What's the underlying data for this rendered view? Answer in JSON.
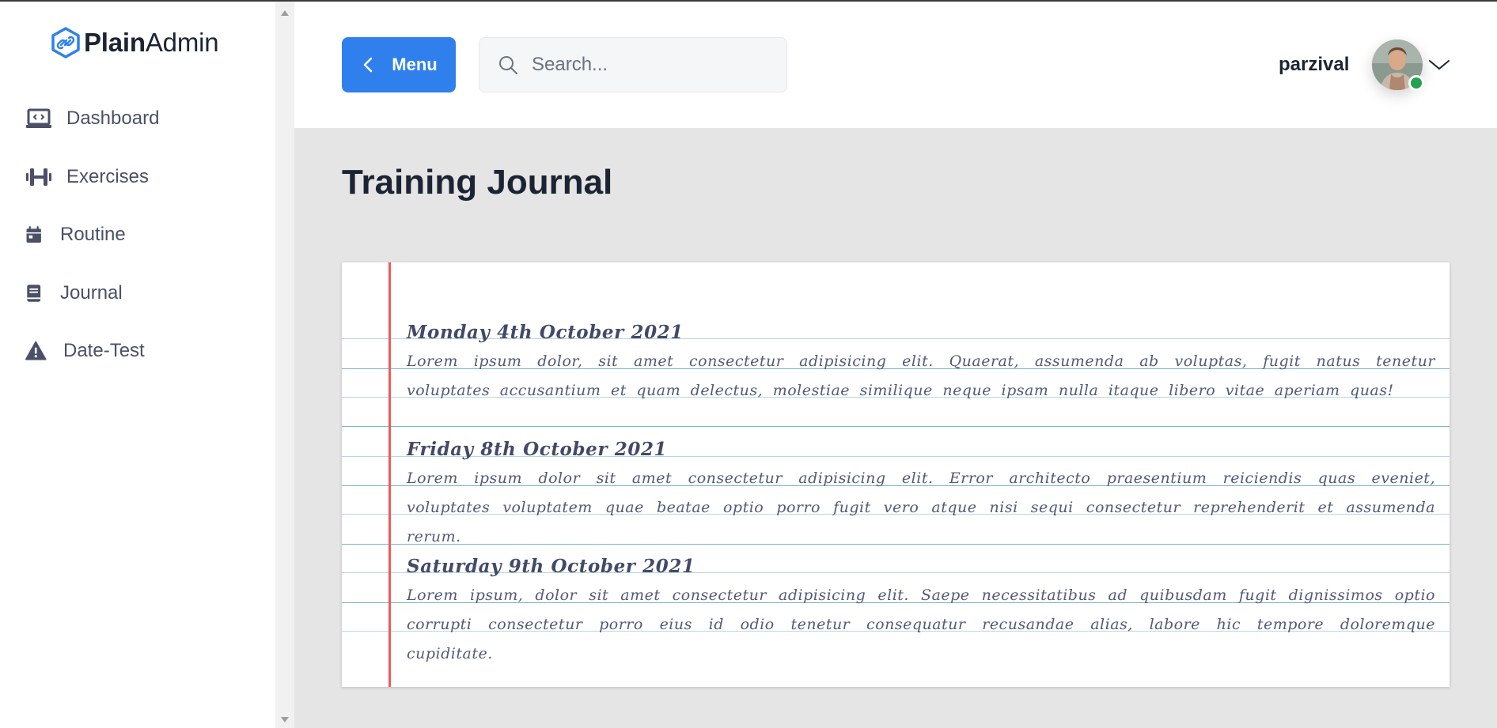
{
  "sidebar": {
    "logo": {
      "bold": "Plain",
      "light": "Admin"
    },
    "items": [
      {
        "label": "Dashboard",
        "icon": "laptop-code-icon"
      },
      {
        "label": "Exercises",
        "icon": "dumbbell-icon"
      },
      {
        "label": "Routine",
        "icon": "calendar-icon"
      },
      {
        "label": "Journal",
        "icon": "book-icon"
      },
      {
        "label": "Date-Test",
        "icon": "warning-triangle-icon"
      }
    ]
  },
  "header": {
    "menu_label": "Menu",
    "search_placeholder": "Search...",
    "search_value": "",
    "user_name": "parzival",
    "status": "online"
  },
  "main": {
    "title": "Training Journal",
    "entries": [
      {
        "date": "Monday 4th October 2021",
        "text": "Lorem ipsum dolor, sit amet consectetur adipisicing elit. Quaerat, assumenda ab voluptas, fugit natus tenetur voluptates accusantium et quam delectus, molestiae similique neque ipsam nulla itaque libero vitae aperiam quas!"
      },
      {
        "date": "Friday 8th October 2021",
        "text": "Lorem ipsum dolor sit amet consectetur adipisicing elit. Error architecto praesentium reiciendis quas eveniet, voluptates voluptatem quae beatae optio porro fugit vero atque nisi sequi consectetur reprehenderit et assumenda rerum."
      },
      {
        "date": "Saturday 9th October 2021",
        "text": "Lorem ipsum, dolor sit amet consectetur adipisicing elit. Saepe necessitatibus ad quibusdam fugit dignissimos optio corrupti consectetur porro eius id odio tenetur consequatur recusandae alias, labore hic tempore doloremque cupiditate."
      }
    ]
  },
  "colors": {
    "accent": "#2f80ed",
    "sidebar_bg": "#ffffff",
    "main_bg": "#e5e5e5",
    "margin_line": "#ef5a5a",
    "ruled_line": "#7db4c8",
    "online": "#21a34f"
  }
}
